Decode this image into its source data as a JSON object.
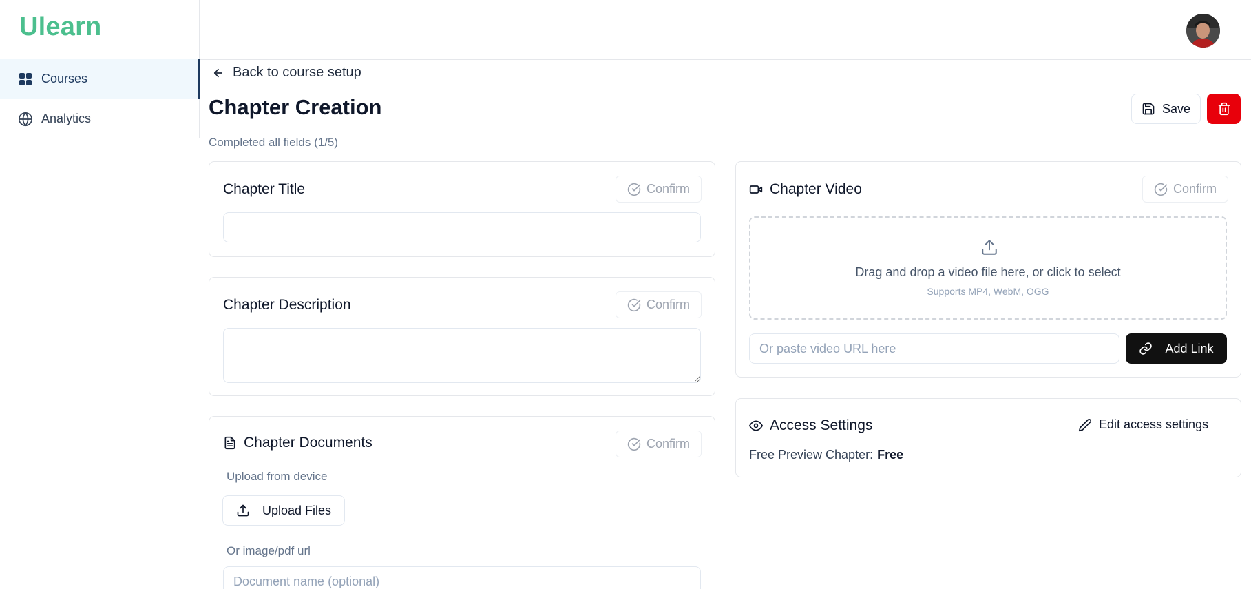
{
  "app": {
    "logo": "Ulearn"
  },
  "sidebar": {
    "items": [
      {
        "label": "Courses",
        "icon": "grid-icon",
        "active": true
      },
      {
        "label": "Analytics",
        "icon": "globe-icon",
        "active": false
      }
    ]
  },
  "header": {
    "avatar": "user-avatar"
  },
  "page": {
    "back_label": "Back to course setup",
    "title": "Chapter Creation",
    "progress": "Completed all fields (1/5)",
    "save_label": "Save"
  },
  "chapter_title": {
    "label": "Chapter Title",
    "confirm_label": "Confirm",
    "value": ""
  },
  "chapter_description": {
    "label": "Chapter Description",
    "confirm_label": "Confirm",
    "value": ""
  },
  "chapter_documents": {
    "label": "Chapter Documents",
    "confirm_label": "Confirm",
    "upload_label": "Upload from device",
    "upload_button": "Upload Files",
    "url_label": "Or image/pdf url",
    "name_placeholder": "Document name (optional)"
  },
  "chapter_video": {
    "label": "Chapter Video",
    "confirm_label": "Confirm",
    "drop_text": "Drag and drop a video file here, or click to select",
    "drop_subtext": "Supports MP4, WebM, OGG",
    "url_placeholder": "Or paste video URL here",
    "add_link_label": "Add Link"
  },
  "access_settings": {
    "label": "Access Settings",
    "edit_label": "Edit access settings",
    "preview_label": "Free Preview Chapter:",
    "preview_value": "Free"
  },
  "colors": {
    "brand": "#4cbf8e",
    "danger": "#e8000b",
    "dark_button": "#111111",
    "active_nav_bg": "#f0f8fd"
  }
}
